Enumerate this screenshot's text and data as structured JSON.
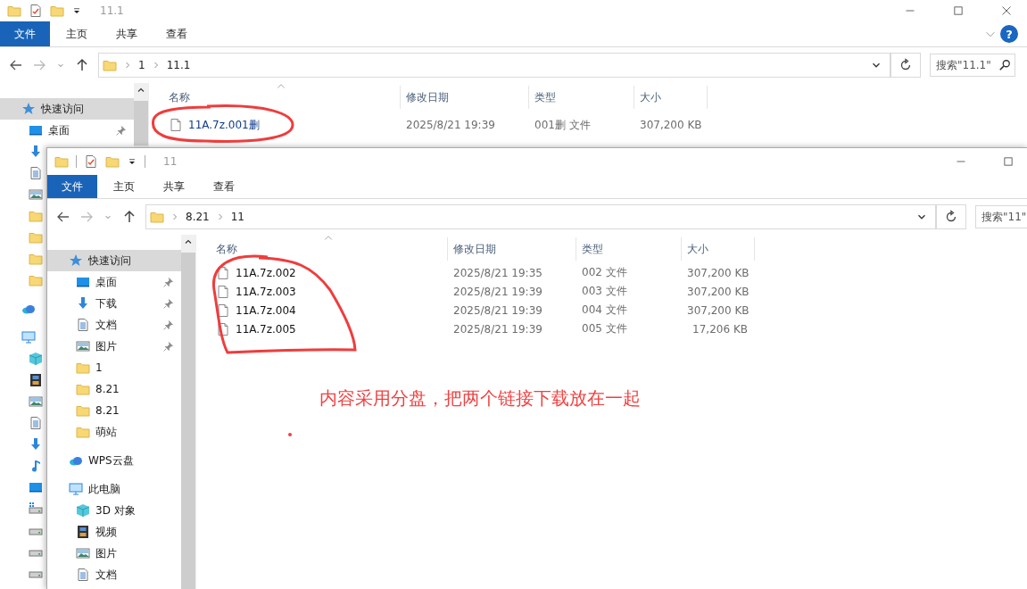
{
  "windows": [
    {
      "title": "11.1",
      "window_buttons": [
        {
          "kind": "minimize"
        },
        {
          "kind": "maximize"
        },
        {
          "kind": "close"
        }
      ],
      "ribbon_tabs": [
        {
          "label": "文件",
          "kind": "file"
        },
        {
          "label": "主页",
          "kind": "tab"
        },
        {
          "label": "共享",
          "kind": "tab"
        },
        {
          "label": "查看",
          "kind": "tab"
        }
      ],
      "help": "?",
      "breadcrumb": [
        "1",
        "11.1"
      ],
      "search": {
        "placeholder": "搜索\"11.1\""
      },
      "nav": [
        {
          "label": "快速访问",
          "kind": "star",
          "selected": true,
          "children": [
            {
              "label": "桌面",
              "kind": "desktop",
              "selected": false,
              "pinned": true
            },
            {
              "kind": "download"
            },
            {
              "kind": "doc"
            },
            {
              "kind": "picture"
            },
            {
              "kind": "folder"
            },
            {
              "kind": "folder"
            },
            {
              "kind": "folder"
            },
            {
              "kind": "folder"
            }
          ]
        },
        {
          "kind": "cloud"
        },
        {
          "kind": "pc",
          "children": [
            {
              "kind": "cube"
            },
            {
              "kind": "film"
            },
            {
              "kind": "picture"
            },
            {
              "kind": "doc"
            },
            {
              "kind": "download"
            },
            {
              "kind": "music"
            },
            {
              "kind": "desktop"
            },
            {
              "kind": "drive-win"
            },
            {
              "kind": "drive"
            },
            {
              "kind": "drive"
            },
            {
              "kind": "drive"
            }
          ]
        }
      ],
      "columns": [
        "名称",
        "修改日期",
        "类型",
        "大小"
      ],
      "files": [
        {
          "name": "11A.7z.001删",
          "modified": "2025/8/21 19:39",
          "type": "001删 文件",
          "size": "307,200 KB"
        }
      ]
    },
    {
      "title": "11",
      "window_buttons": [
        {
          "kind": "minimize"
        },
        {
          "kind": "maximize"
        }
      ],
      "ribbon_tabs": [
        {
          "label": "文件",
          "kind": "file"
        },
        {
          "label": "主页",
          "kind": "tab"
        },
        {
          "label": "共享",
          "kind": "tab"
        },
        {
          "label": "查看",
          "kind": "tab"
        }
      ],
      "breadcrumb": [
        "8.21",
        "11"
      ],
      "search": {
        "placeholder": "搜索\"11\""
      },
      "nav": [
        {
          "label": "快速访问",
          "kind": "star",
          "selected": true,
          "children": [
            {
              "label": "桌面",
              "kind": "desktop",
              "selected": false,
              "pinned": true
            },
            {
              "label": "下载",
              "kind": "download",
              "selected": false,
              "pinned": true
            },
            {
              "label": "文档",
              "kind": "doc",
              "selected": false,
              "pinned": true
            },
            {
              "label": "图片",
              "kind": "picture",
              "selected": false,
              "pinned": true
            },
            {
              "label": "1",
              "kind": "folder",
              "selected": false,
              "pinned": false
            },
            {
              "label": "8.21",
              "kind": "folder",
              "selected": false,
              "pinned": false
            },
            {
              "label": "8.21",
              "kind": "folder",
              "selected": false,
              "pinned": false
            },
            {
              "label": "萌站",
              "kind": "folder",
              "selected": false,
              "pinned": false
            }
          ]
        },
        {
          "label": "WPS云盘",
          "kind": "cloud",
          "selected": false
        },
        {
          "label": "此电脑",
          "kind": "pc",
          "selected": false,
          "children": [
            {
              "label": "3D 对象",
              "kind": "cube",
              "selected": false
            },
            {
              "label": "视频",
              "kind": "film",
              "selected": false
            },
            {
              "label": "图片",
              "kind": "picture",
              "selected": false
            },
            {
              "label": "文档",
              "kind": "doc",
              "selected": false
            }
          ]
        }
      ],
      "columns": [
        "名称",
        "修改日期",
        "类型",
        "大小"
      ],
      "files": [
        {
          "name": "11A.7z.002",
          "modified": "2025/8/21 19:35",
          "type": "002 文件",
          "size": "307,200 KB"
        },
        {
          "name": "11A.7z.003",
          "modified": "2025/8/21 19:39",
          "type": "003 文件",
          "size": "307,200 KB"
        },
        {
          "name": "11A.7z.004",
          "modified": "2025/8/21 19:39",
          "type": "004 文件",
          "size": "307,200 KB"
        },
        {
          "name": "11A.7z.005",
          "modified": "2025/8/21 19:39",
          "type": "005 文件",
          "size": "17,206 KB"
        }
      ],
      "annotation": "内容采用分盘，把两个链接下载放在一起"
    }
  ]
}
